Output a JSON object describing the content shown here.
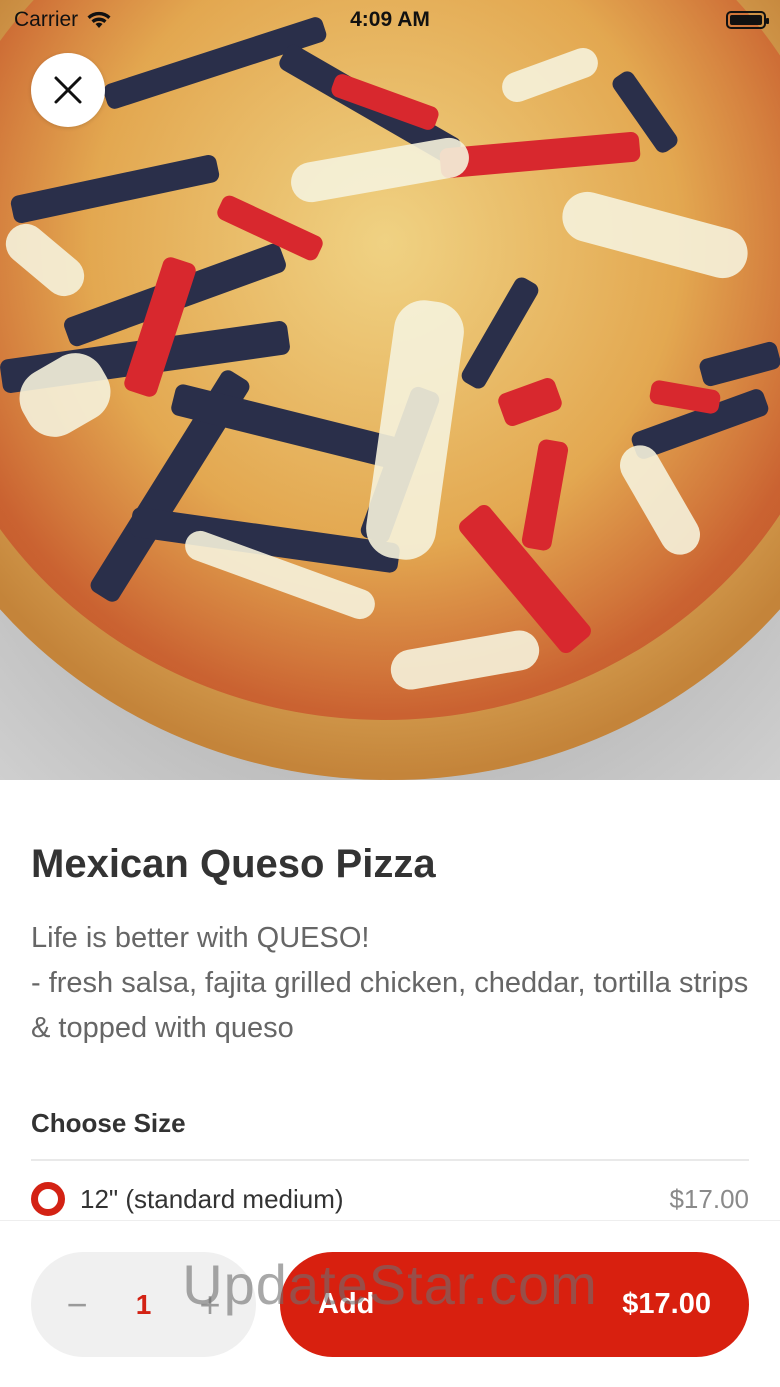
{
  "status_bar": {
    "carrier": "Carrier",
    "time": "4:09 AM"
  },
  "hero": {
    "image_subject": "pizza-photo"
  },
  "item": {
    "title": "Mexican Queso Pizza",
    "description": "Life is better with QUESO!\n- fresh salsa, fajita grilled chicken, cheddar, tortilla strips & topped with queso"
  },
  "size_section": {
    "title": "Choose Size",
    "options": [
      {
        "label": "12\" (standard medium)",
        "price": "$17.00",
        "selected": true
      }
    ]
  },
  "order_bar": {
    "minus": "−",
    "quantity": "1",
    "plus": "+",
    "add_label": "Add",
    "total": "$17.00"
  },
  "watermark": "UpdateStar.com",
  "colors": {
    "accent": "#d8200f",
    "text_primary": "#333333",
    "text_secondary": "#666666"
  }
}
